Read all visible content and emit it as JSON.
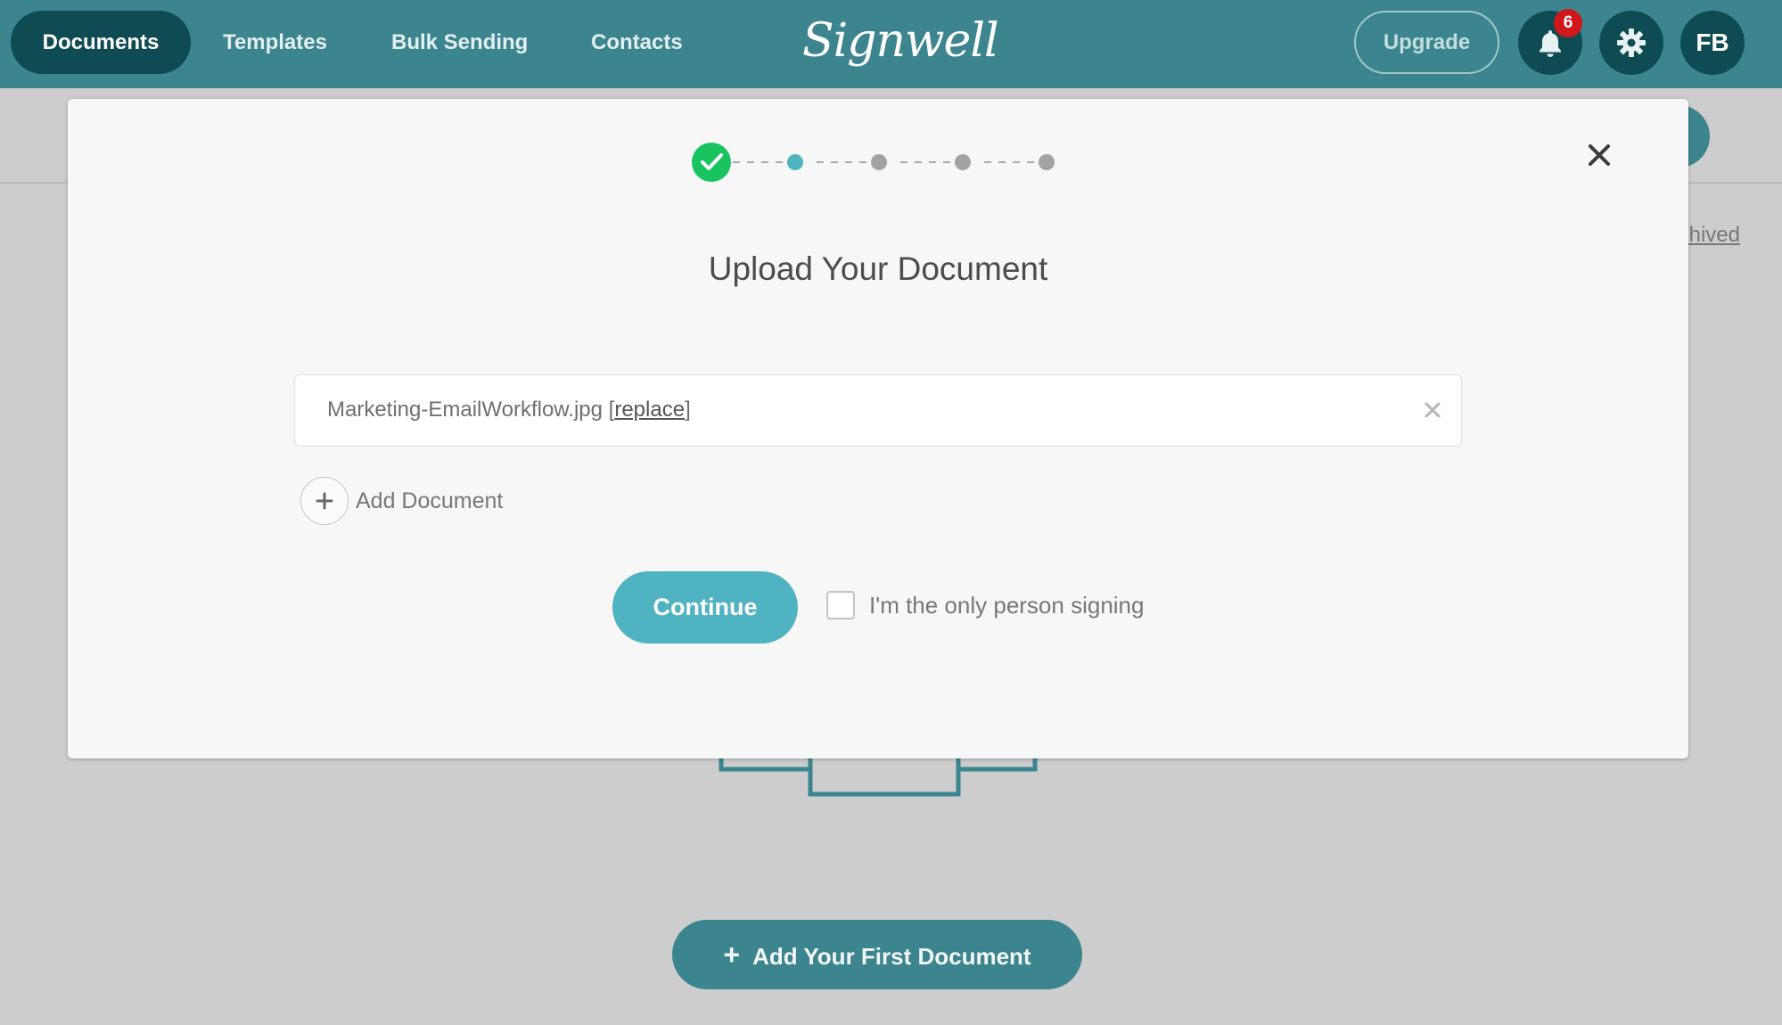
{
  "nav": {
    "items": [
      {
        "label": "Documents",
        "active": true
      },
      {
        "label": "Templates"
      },
      {
        "label": "Bulk Sending"
      },
      {
        "label": "Contacts"
      }
    ],
    "logo": "Signwell",
    "upgrade_label": "Upgrade",
    "notifications_count": "6",
    "settings_icon": "gear-icon",
    "avatar_initials": "FB"
  },
  "background": {
    "archived_link": "Archived",
    "add_first_document": "Add Your First Document"
  },
  "modal": {
    "title": "Upload Your Document",
    "stepper": {
      "total_steps": 5,
      "completed_steps": 1,
      "current_step": 2
    },
    "file": {
      "name": "Marketing-EmailWorkflow.jpg",
      "replace_open": "[",
      "replace_label": "replace",
      "replace_close": "]"
    },
    "add_document_label": "Add Document",
    "continue_label": "Continue",
    "only_signer_label": "I'm the only person signing",
    "only_signer_checked": false
  },
  "colors": {
    "brand": "#3c858f",
    "brand_dark": "#0f4b52",
    "accent": "#4fb3c2",
    "success": "#19c460",
    "badge": "#d0181c"
  }
}
